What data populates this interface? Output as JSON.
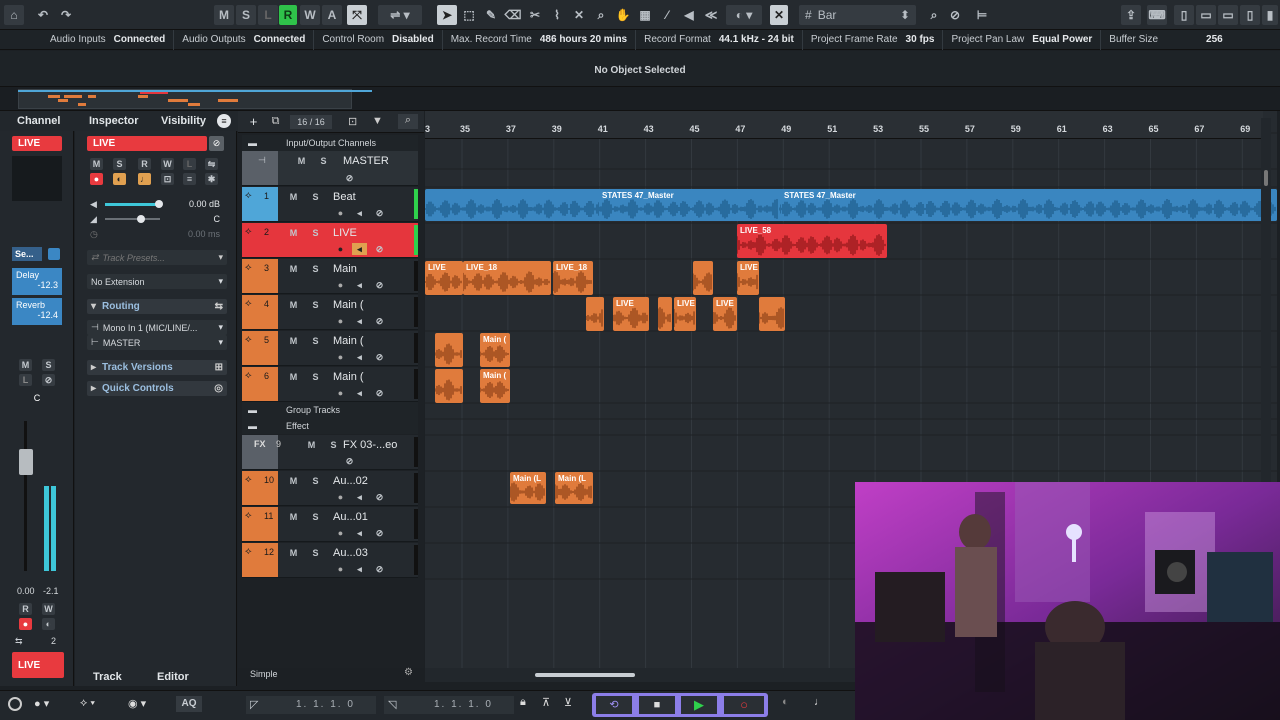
{
  "toolbar": {
    "modes": [
      "M",
      "S",
      "L",
      "R",
      "W",
      "A"
    ],
    "grid": "Bar"
  },
  "status": [
    {
      "label": "Audio Inputs",
      "value": "Connected"
    },
    {
      "label": "Audio Outputs",
      "value": "Connected"
    },
    {
      "label": "Control Room",
      "value": "Disabled"
    },
    {
      "label": "Max. Record Time",
      "value": "486 hours 20 mins"
    },
    {
      "label": "Record Format",
      "value": "44.1 kHz - 24 bit"
    },
    {
      "label": "Project Frame Rate",
      "value": "30 fps"
    },
    {
      "label": "Project Pan Law",
      "value": "Equal Power"
    },
    {
      "label": "Buffer Size",
      "value": "256"
    }
  ],
  "info": {
    "no_object": "No Object Selected"
  },
  "left": {
    "tab_channel": "Channel",
    "tab_inspector": "Inspector",
    "tab_visibility": "Visibility",
    "live": "LIVE",
    "channel_live": "LIVE",
    "bottom_live": "LIVE",
    "sends": [
      {
        "name": "Delay",
        "value": "-12.3"
      },
      {
        "name": "Reverb",
        "value": "-12.4"
      }
    ],
    "se_label": "Se...",
    "meter_vals": [
      "0.00",
      "-2.1"
    ],
    "c_label": "C",
    "pan_num": "2",
    "volume": "0.00 dB",
    "pan": "C",
    "delay": "0.00 ms",
    "presets_placeholder": "Track Presets...",
    "extension": "No Extension",
    "routing": "Routing",
    "input": "Mono In 1 (MIC/LINE/...",
    "output": "MASTER",
    "track_versions": "Track Versions",
    "quick_controls": "Quick Controls",
    "tab_track": "Track",
    "tab_editor": "Editor"
  },
  "tracklist": {
    "count": "16 / 16",
    "folder_io": "Input/Output Channels",
    "master": "MASTER",
    "folder_group": "Group Tracks",
    "folder_effect": "Effect",
    "fx_label": "FX",
    "mode": "Simple",
    "tracks": [
      {
        "num": "1",
        "name": "Beat",
        "color": "#4fa6d8"
      },
      {
        "num": "2",
        "name": "LIVE",
        "color": "#e5363d"
      },
      {
        "num": "3",
        "name": "Main",
        "color": "#e07b3c"
      },
      {
        "num": "4",
        "name": "Main (",
        "color": "#e07b3c"
      },
      {
        "num": "5",
        "name": "Main (",
        "color": "#e07b3c"
      },
      {
        "num": "6",
        "name": "Main (",
        "color": "#e07b3c"
      },
      {
        "num": "9",
        "name": "FX 03-...eo",
        "color": "#5a6068"
      },
      {
        "num": "10",
        "name": "Au...02",
        "color": "#e07b3c"
      },
      {
        "num": "11",
        "name": "Au...01",
        "color": "#e07b3c"
      },
      {
        "num": "12",
        "name": "Au...03",
        "color": "#e07b3c"
      }
    ]
  },
  "ruler": [
    "3",
    "35",
    "37",
    "39",
    "41",
    "43",
    "45",
    "47",
    "49",
    "51",
    "53",
    "55",
    "57",
    "59",
    "61",
    "63",
    "65",
    "67",
    "69"
  ],
  "clips": {
    "beat": [
      "STATES 47_Master",
      "STATES 47_Master"
    ],
    "live": "LIVE_58",
    "main": [
      "LIVE",
      "LIVE_18",
      "LIVE_18",
      "LIVE"
    ],
    "main2": [
      "LIVE",
      "LIVE",
      "LIVE"
    ],
    "main_small": [
      "Main (",
      "Main ("
    ],
    "au": [
      "Main (L",
      "Main (L"
    ]
  },
  "transport": {
    "left_pos": "1. 1. 1.   0",
    "right_pos": "1. 1. 1.   0",
    "aq": "AQ"
  },
  "colors": {
    "live": "#e83a3f",
    "audio": "#e07b3c",
    "beat": "#4fa6d8",
    "accent": "#5cc8e8"
  }
}
